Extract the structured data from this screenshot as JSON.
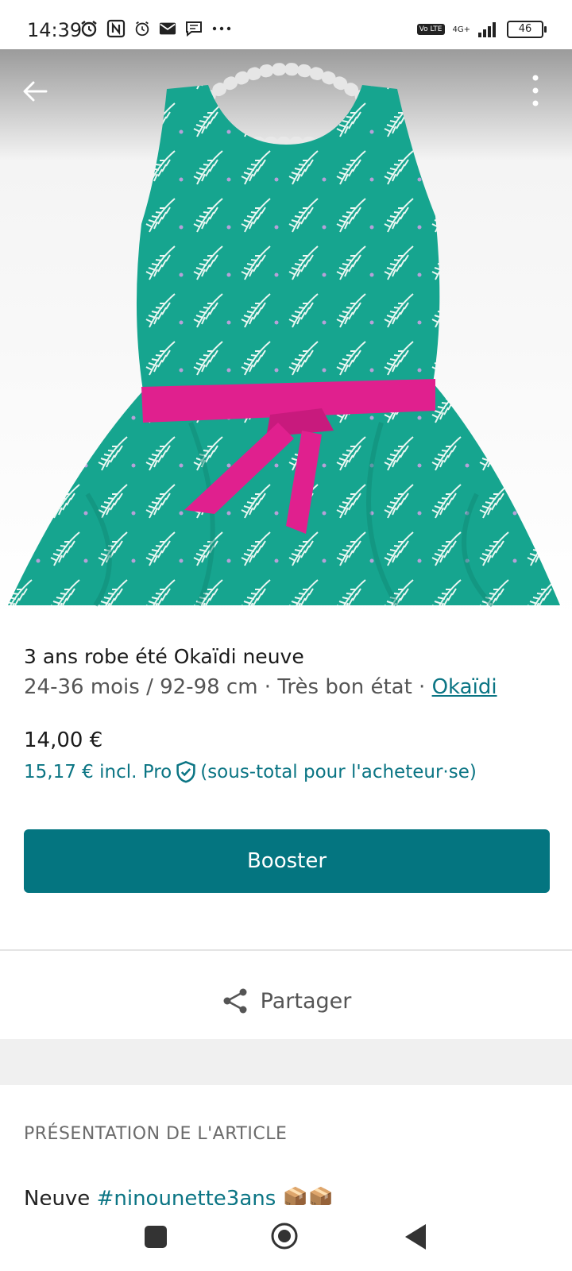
{
  "status_bar": {
    "time": "14:39",
    "volte_label": "Vo LTE",
    "network": "4G+",
    "battery": "46"
  },
  "listing": {
    "title": "3 ans robe été Okaïdi neuve",
    "details": "24-36 mois / 92-98 cm · Très bon état · ",
    "brand": "Okaïdi",
    "price": "14,00 €",
    "pro_price": "15,17 € incl. Pro",
    "pro_note": "(sous-total pour l'acheteur·se)",
    "accent_color": "#047580"
  },
  "actions": {
    "booster_label": "Booster",
    "share_label": "Partager"
  },
  "description": {
    "section_title": "PRÉSENTATION DE L'ARTICLE",
    "text_start": "Neuve ",
    "hashtag": "#ninounette3ans",
    "emoji": "📦📦"
  }
}
